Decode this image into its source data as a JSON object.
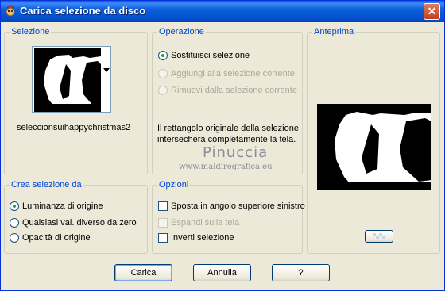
{
  "window": {
    "title": "Carica selezione da disco",
    "close_icon": "close-icon",
    "app_icon": "app-icon"
  },
  "selezione": {
    "title": "Selezione",
    "file_name": "seleccionsuihappychristmas2",
    "thumbnail": "selection-thumbnail"
  },
  "operazione": {
    "title": "Operazione",
    "options": [
      {
        "label": "Sostituisci selezione",
        "checked": true,
        "enabled": true
      },
      {
        "label": "Aggiungi alla selezione corrente",
        "checked": false,
        "enabled": false
      },
      {
        "label": "Rimuovi dalla selezione corrente",
        "checked": false,
        "enabled": false
      }
    ],
    "info_line1": "Il rettangolo originale della selezione",
    "info_line2": "intersecherà completamente la tela."
  },
  "anteprima": {
    "title": "Anteprima"
  },
  "crea": {
    "title": "Crea selezione da",
    "options": [
      {
        "label": "Luminanza di origine",
        "checked": true
      },
      {
        "label": "Qualsiasi val. diverso da zero",
        "checked": false
      },
      {
        "label": "Opacità di origine",
        "checked": false
      }
    ]
  },
  "opzioni": {
    "title": "Opzioni",
    "items": [
      {
        "label": "Sposta in angolo superiore sinistro",
        "checked": false,
        "enabled": true
      },
      {
        "label": "Espandi sulla tela",
        "checked": false,
        "enabled": false
      },
      {
        "label": "Inverti selezione",
        "checked": false,
        "enabled": true
      }
    ]
  },
  "watermark": {
    "name": "Pinuccia",
    "url": "www.maidiregrafica.eu"
  },
  "buttons": {
    "carica": "Carica",
    "annulla": "Annulla",
    "help": "?"
  },
  "colors": {
    "accent": "#0046d5",
    "titlebar": "#0a5fd8",
    "face": "#ece9d8",
    "radio_dot": "#21a121"
  }
}
